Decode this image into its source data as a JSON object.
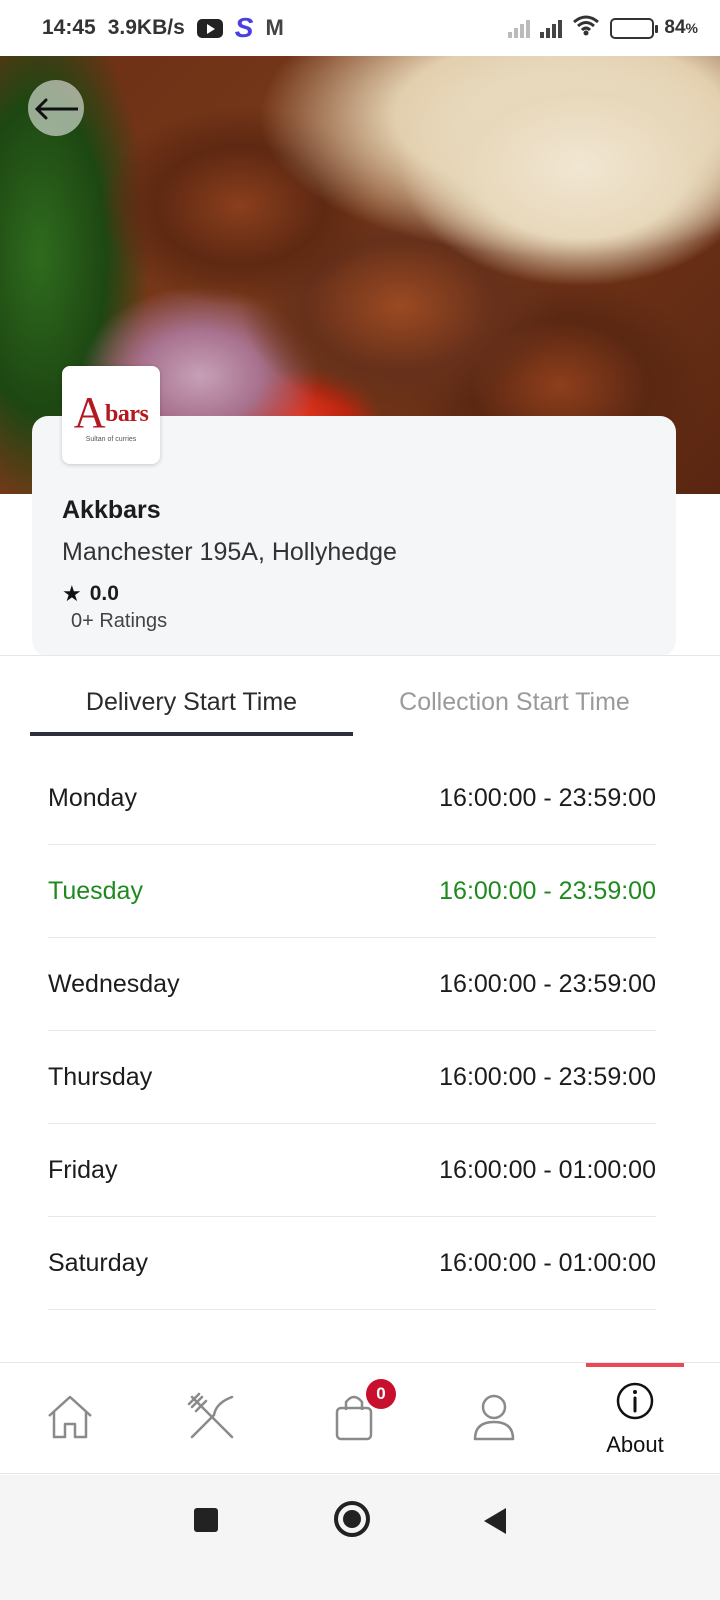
{
  "status_bar": {
    "time": "14:45",
    "speed": "3.9KB/s",
    "battery_percent": "84",
    "battery_suffix": "%",
    "icons": [
      "youtube-icon",
      "s-app-icon",
      "gmail-icon",
      "signal-icon",
      "wifi-icon",
      "battery-icon"
    ]
  },
  "restaurant": {
    "name": "Akkbars",
    "address": "Manchester 195A, Hollyhedge",
    "rating": "0.0",
    "ratings_count": "0+ Ratings",
    "logo_text": "bars",
    "logo_initial": "A",
    "logo_subtitle": "Sultan of curries"
  },
  "tabs": [
    {
      "label": "Delivery Start Time",
      "active": true
    },
    {
      "label": "Collection Start Time",
      "active": false
    }
  ],
  "schedule": [
    {
      "day": "Monday",
      "hours": "16:00:00 - 23:59:00",
      "highlight": false
    },
    {
      "day": "Tuesday",
      "hours": "16:00:00 - 23:59:00",
      "highlight": true
    },
    {
      "day": "Wednesday",
      "hours": "16:00:00 - 23:59:00",
      "highlight": false
    },
    {
      "day": "Thursday",
      "hours": "16:00:00 - 23:59:00",
      "highlight": false
    },
    {
      "day": "Friday",
      "hours": "16:00:00 - 01:00:00",
      "highlight": false
    },
    {
      "day": "Saturday",
      "hours": "16:00:00 - 01:00:00",
      "highlight": false
    }
  ],
  "bottom_nav": {
    "items": [
      {
        "icon": "home-icon"
      },
      {
        "icon": "fork-knife-icon"
      },
      {
        "icon": "shopping-bag-icon",
        "badge": "0"
      },
      {
        "icon": "user-icon"
      },
      {
        "icon": "info-icon",
        "label": "About",
        "active": true
      }
    ]
  },
  "colors": {
    "active_day": "#1e8a1e",
    "badge": "#c8102e",
    "nav_indicator": "#e84a55",
    "tab_underline": "#2d2f3a"
  }
}
